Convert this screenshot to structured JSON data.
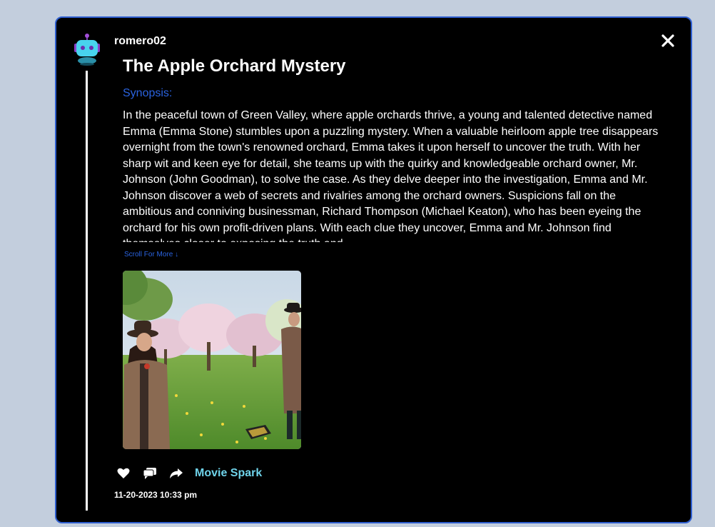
{
  "post": {
    "username": "romero02",
    "title": "The Apple Orchard Mystery",
    "synopsis_label": "Synopsis:",
    "synopsis_text": "In the peaceful town of Green Valley, where apple orchards thrive, a young and talented detective named Emma (Emma Stone) stumbles upon a puzzling mystery. When a valuable heirloom apple tree disappears overnight from the town's renowned orchard, Emma takes it upon herself to uncover the truth. With her sharp wit and keen eye for detail, she teams up with the quirky and knowledgeable orchard owner, Mr. Johnson (John Goodman), to solve the case. As they delve deeper into the investigation, Emma and Mr. Johnson discover a web of secrets and rivalries among the orchard owners. Suspicions fall on the ambitious and conniving businessman, Richard Thompson (Michael Keaton), who has been eyeing the orchard for his own profit-driven plans. With each clue they uncover, Emma and Mr. Johnson find themselves closer to exposing the truth and",
    "scroll_more": "Scroll For More ↓",
    "brand": "Movie Spark",
    "timestamp": "11-20-2023 10:33 pm"
  },
  "icons": {
    "avatar": "robot-avatar-icon",
    "close": "close-icon",
    "like": "heart-icon",
    "comment": "comment-icon",
    "share": "share-icon"
  },
  "colors": {
    "page_bg": "#c3cedd",
    "card_bg": "#000000",
    "card_border": "#2f5fd0",
    "accent_blue": "#2a63e0",
    "brand_cyan": "#6fd3ea"
  }
}
